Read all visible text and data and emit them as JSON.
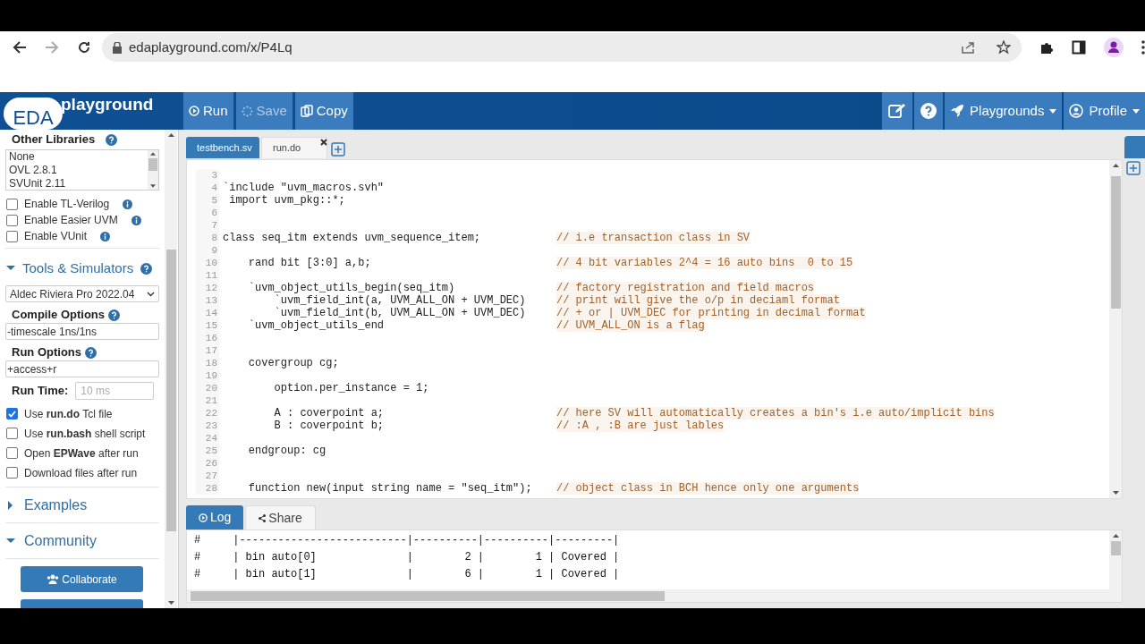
{
  "browser": {
    "url": "edaplayground.com/x/P4Lq"
  },
  "header": {
    "logo_badge": "EDA",
    "logo_text": "playground",
    "buttons": [
      {
        "label": "Run",
        "disabled": false
      },
      {
        "label": "Save",
        "disabled": true
      },
      {
        "label": "Copy",
        "disabled": false
      }
    ],
    "right_buttons": [
      {
        "kind": "icon"
      },
      {
        "kind": "icon"
      },
      {
        "kind": "menu",
        "label": "Playgrounds"
      },
      {
        "kind": "menu",
        "label": "Profile"
      }
    ]
  },
  "sidebar": {
    "other_libraries": {
      "title": "Other Libraries",
      "options": [
        "None",
        "OVL 2.8.1",
        "SVUnit 2.11"
      ]
    },
    "library_checkboxes": [
      {
        "label": "Enable TL-Verilog",
        "checked": false
      },
      {
        "label": "Enable Easier UVM",
        "checked": false
      },
      {
        "label": "Enable VUnit",
        "checked": false
      }
    ],
    "tools": {
      "title": "Tools & Simulators",
      "expanded": true
    },
    "simulator": "Aldec Riviera Pro 2022.04",
    "compile_options": {
      "label": "Compile Options",
      "value": "-timescale 1ns/1ns"
    },
    "run_options": {
      "label": "Run Options",
      "value": "+access+r"
    },
    "run_time": {
      "label": "Run Time:",
      "placeholder": "10 ms"
    },
    "run_checkboxes": [
      {
        "label": "Use **run.do** Tcl file",
        "checked": true
      },
      {
        "label": "Use **run.bash** shell script",
        "checked": false
      },
      {
        "label": "Open **EPWave** after run",
        "checked": false
      },
      {
        "label": "Download files after run",
        "checked": false
      }
    ],
    "sections": [
      {
        "title": "Examples",
        "expanded": false
      },
      {
        "title": "Community",
        "expanded": true
      }
    ],
    "community_button": "Collaborate"
  },
  "editor": {
    "tabs": [
      {
        "label": "testbench.sv",
        "selected": true
      },
      {
        "label": "run.do",
        "selected": false
      }
    ],
    "lines": [
      {
        "number": "3"
      },
      {
        "number": "4",
        "code": "`include \"uvm_macros.svh\""
      },
      {
        "number": "5",
        "code": " import uvm_pkg::*;"
      },
      {
        "number": "6"
      },
      {
        "number": "7"
      },
      {
        "number": "8",
        "code": "class seq_itm extends uvm_sequence_item;",
        "comment": "// i.e transaction class in SV"
      },
      {
        "number": "9"
      },
      {
        "number": "10",
        "code": "    rand bit [3:0] a,b;",
        "comment": "// 4 bit variables 2^4 = 16 auto bins  0 to 15"
      },
      {
        "number": "11"
      },
      {
        "number": "12",
        "code": "    `uvm_object_utils_begin(seq_itm)",
        "comment": "// factory registration and field macros"
      },
      {
        "number": "13",
        "code": "        `uvm_field_int(a, UVM_ALL_ON + UVM_DEC)",
        "comment": "// print will give the o/p in deciaml format"
      },
      {
        "number": "14",
        "code": "        `uvm_field_int(b, UVM_ALL_ON + UVM_DEC)",
        "comment": "// + or | UVM_DEC for printing in decimal format"
      },
      {
        "number": "15",
        "code": "    `uvm_object_utils_end",
        "comment": "// UVM_ALL_ON is a flag"
      },
      {
        "number": "16"
      },
      {
        "number": "17"
      },
      {
        "number": "18",
        "code": "    covergroup cg;"
      },
      {
        "number": "19"
      },
      {
        "number": "20",
        "code": "        option.per_instance = 1;"
      },
      {
        "number": "21"
      },
      {
        "number": "22",
        "code": "        A : coverpoint a;",
        "comment": "// here SV will automatically creates a bin's i.e auto/implicit bins"
      },
      {
        "number": "23",
        "code": "        B : coverpoint b;",
        "comment": "// :A , :B are just lables"
      },
      {
        "number": "24"
      },
      {
        "number": "25",
        "code": "    endgroup: cg"
      },
      {
        "number": "26"
      },
      {
        "number": "27"
      },
      {
        "number": "28",
        "code": "    function new(input string name = \"seq_itm\");",
        "comment": "// object class in BCH hence only one arguments"
      }
    ]
  },
  "log": {
    "tabs": [
      {
        "label": "Log",
        "selected": true
      },
      {
        "label": "Share",
        "selected": false
      }
    ],
    "lines": [
      "#     |--------------------------|----------|----------|---------|",
      "#     | bin auto[0]              |        2 |        1 | Covered |",
      "#     | bin auto[1]              |        6 |        1 | Covered |"
    ]
  }
}
